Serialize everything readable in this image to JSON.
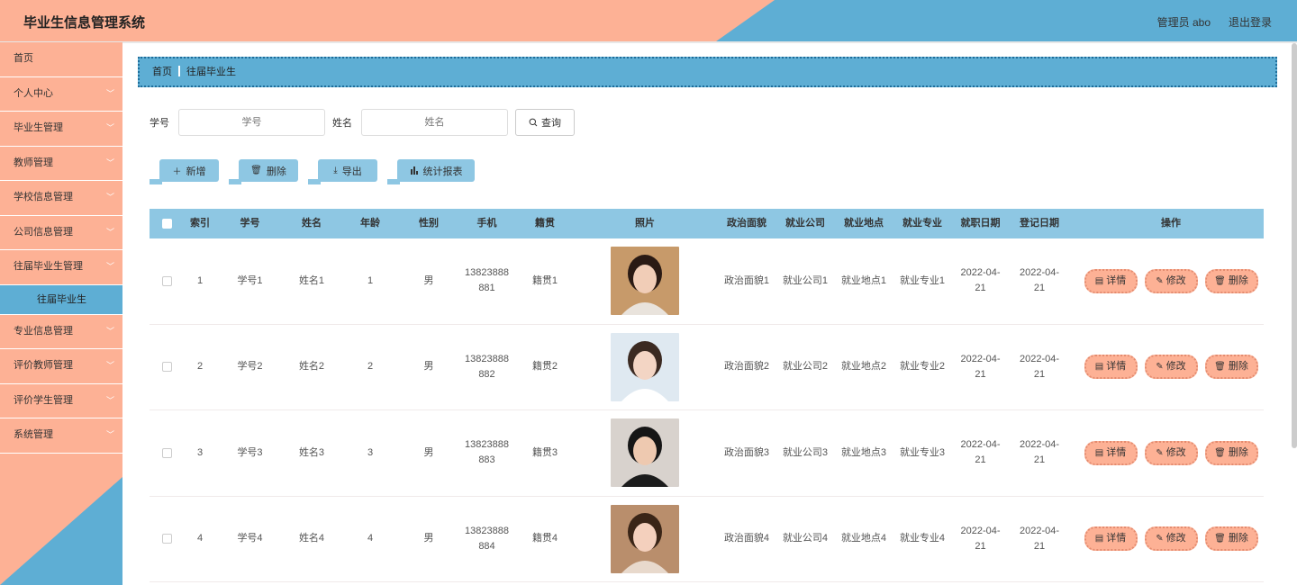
{
  "header": {
    "title": "毕业生信息管理系统",
    "user": "管理员 abo",
    "logout": "退出登录"
  },
  "sidebar": {
    "items": [
      {
        "label": "首页",
        "chevron": false
      },
      {
        "label": "个人中心",
        "chevron": true
      },
      {
        "label": "毕业生管理",
        "chevron": true
      },
      {
        "label": "教师管理",
        "chevron": true
      },
      {
        "label": "学校信息管理",
        "chevron": true
      },
      {
        "label": "公司信息管理",
        "chevron": true
      },
      {
        "label": "往届毕业生管理",
        "chevron": true
      }
    ],
    "sub_item": "往届毕业生",
    "items_after": [
      {
        "label": "专业信息管理",
        "chevron": true
      },
      {
        "label": "评价教师管理",
        "chevron": true
      },
      {
        "label": "评价学生管理",
        "chevron": true
      },
      {
        "label": "系统管理",
        "chevron": true
      }
    ]
  },
  "breadcrumb": {
    "home": "首页",
    "current": "往届毕业生"
  },
  "search": {
    "sno_label": "学号",
    "sno_placeholder": "学号",
    "name_label": "姓名",
    "name_placeholder": "姓名",
    "query_label": "查询"
  },
  "actions": {
    "add": "新增",
    "delete": "删除",
    "export": "导出",
    "report": "统计报表"
  },
  "table": {
    "headers": [
      "索引",
      "学号",
      "姓名",
      "年龄",
      "性别",
      "手机",
      "籍贯",
      "照片",
      "政治面貌",
      "就业公司",
      "就业地点",
      "就业专业",
      "就职日期",
      "登记日期",
      "操作"
    ],
    "rows": [
      {
        "idx": "1",
        "sno": "学号1",
        "name": "姓名1",
        "age": "1",
        "sex": "男",
        "phone_a": "13823888",
        "phone_b": "881",
        "home": "籍贯1",
        "pol": "政治面貌1",
        "co": "就业公司1",
        "loc": "就业地点1",
        "major": "就业专业1",
        "d1_a": "2022-04-",
        "d1_b": "21",
        "d2_a": "2022-04-",
        "d2_b": "21"
      },
      {
        "idx": "2",
        "sno": "学号2",
        "name": "姓名2",
        "age": "2",
        "sex": "男",
        "phone_a": "13823888",
        "phone_b": "882",
        "home": "籍贯2",
        "pol": "政治面貌2",
        "co": "就业公司2",
        "loc": "就业地点2",
        "major": "就业专业2",
        "d1_a": "2022-04-",
        "d1_b": "21",
        "d2_a": "2022-04-",
        "d2_b": "21"
      },
      {
        "idx": "3",
        "sno": "学号3",
        "name": "姓名3",
        "age": "3",
        "sex": "男",
        "phone_a": "13823888",
        "phone_b": "883",
        "home": "籍贯3",
        "pol": "政治面貌3",
        "co": "就业公司3",
        "loc": "就业地点3",
        "major": "就业专业3",
        "d1_a": "2022-04-",
        "d1_b": "21",
        "d2_a": "2022-04-",
        "d2_b": "21"
      },
      {
        "idx": "4",
        "sno": "学号4",
        "name": "姓名4",
        "age": "4",
        "sex": "男",
        "phone_a": "13823888",
        "phone_b": "884",
        "home": "籍贯4",
        "pol": "政治面貌4",
        "co": "就业公司4",
        "loc": "就业地点4",
        "major": "就业专业4",
        "d1_a": "2022-04-",
        "d1_b": "21",
        "d2_a": "2022-04-",
        "d2_b": "21"
      }
    ],
    "op_detail": "详情",
    "op_edit": "修改",
    "op_delete": "删除"
  },
  "colors": {
    "salmon": "#fdb195",
    "blue": "#5eaed4",
    "light_blue": "#8ec7e3"
  }
}
